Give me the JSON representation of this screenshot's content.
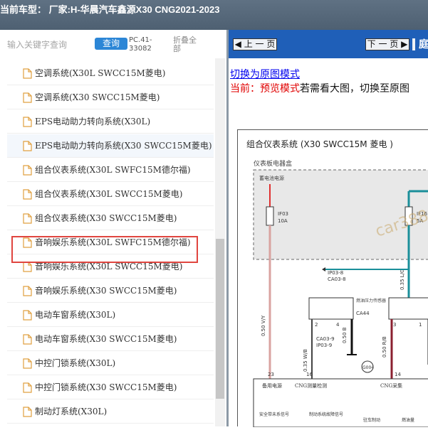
{
  "header": {
    "title": "当前车型：  厂家:H-华晨汽车鑫源X30 CNG2021-2023"
  },
  "search": {
    "placeholder": "输入关键字查询",
    "button": "查询",
    "code": "PC.41-33082",
    "collapse": "折叠全部"
  },
  "list": [
    "空调系统(X30L SWCC15M菱电)",
    "空调系统(X30 SWCC15M菱电)",
    "EPS电动助力转向系统(X30L)",
    "EPS电动助力转向系统(X30 SWCC15M菱电)",
    "组合仪表系统(X30L SWFC15M德尔福)",
    "组合仪表系统(X30L SWCC15M菱电)",
    "组合仪表系统(X30 SWCC15M菱电)",
    "音响娱乐系统(X30L SWFC15M德尔福)",
    "音响娱乐系统(X30L SWCC15M菱电)",
    "音响娱乐系统(X30 SWCC15M菱电)",
    "电动车窗系统(X30L)",
    "电动车窗系统(X30 SWCC15M菱电)",
    "中控门锁系统(X30L)",
    "中控门锁系统(X30 SWCC15M菱电)",
    "制动灯系统(X30L)"
  ],
  "viewer": {
    "prev": "上 一 页",
    "next": "下 一 页",
    "extra": "庭",
    "switch_link": "切换为原图模式",
    "current_prefix": "当前：",
    "mode_name": "预览模式",
    "hint": "若需看大图，切换至原图"
  },
  "diagram": {
    "title": "组合仪表系统 (X30 SWCC15M 菱电 )",
    "panel_box": "仪表板电器盒",
    "power_label": "蓄电池电源",
    "fuse1": "IF03",
    "fuse1_amp": "10A",
    "fuse2": "IF16",
    "fuse2_amp": "5A",
    "wire1": "0.50 V/Y",
    "wire2": "0.35 L/G",
    "conn1": "IP03-8",
    "conn1b": "CA03-8",
    "module_name": "燃油压力传感器",
    "module_code": "CA44",
    "conn2": "CA03-9",
    "conn2b": "IP03-9",
    "wire3": "0.35 W/B",
    "wire4": "0.50 B",
    "wire5": "0.50 R/B",
    "ground": "G004",
    "pin_23": "23",
    "pin_16": "16",
    "pin_14": "14",
    "pin_2": "2",
    "pin_4": "4",
    "pin_3": "3",
    "pin_1": "1",
    "bottom_1": "备用电源",
    "bottom_2": "CNG测量检测",
    "bottom_3": "CNG采集",
    "bottom_4": "安全带未系信号",
    "bottom_5": "制动系统故障信号",
    "bottom_6": "驻车制动",
    "bottom_7": "燃油量",
    "watermark": "car388.com"
  },
  "colors": {
    "highlight": "#e0453f",
    "search_button": "#2c86d6",
    "nav": "#1f5fb8",
    "mode_red": "#e00000"
  }
}
